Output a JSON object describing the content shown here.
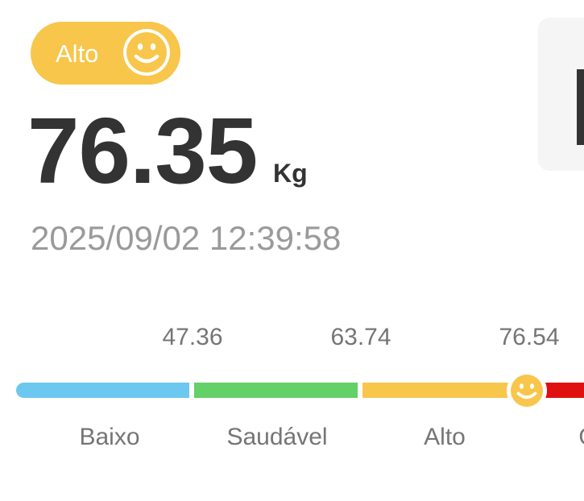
{
  "status": {
    "label": "Alto",
    "icon": "smiley-face-icon",
    "color": "#f7c64b"
  },
  "measurement": {
    "value": "76.35",
    "unit": "Kg",
    "timestamp": "2025/09/02 12:39:58"
  },
  "scale": {
    "thresholds": [
      "47.36",
      "63.74",
      "76.54"
    ],
    "zones": [
      {
        "label": "Baixo",
        "color": "#6cc8ef"
      },
      {
        "label": "Saudável",
        "color": "#63d068"
      },
      {
        "label": "Alto",
        "color": "#f7c64b"
      },
      {
        "label": "O",
        "color": "#e01010"
      }
    ],
    "marker_icon": "smiley-face-icon",
    "marker_zone": "Alto"
  }
}
